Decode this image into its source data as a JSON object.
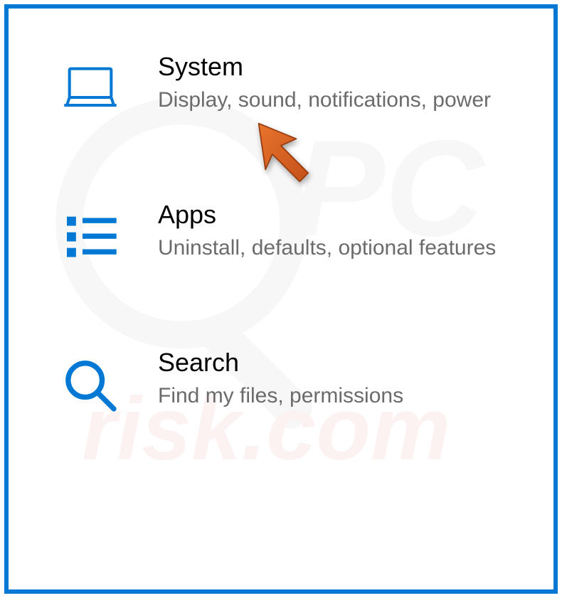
{
  "colors": {
    "border": "#0078d4",
    "icon": "#0078d4",
    "title": "#000000",
    "subtitle": "#6b6b6b",
    "cursor": "#d9641f"
  },
  "watermark": {
    "text_top": "PC",
    "text_bottom": "risk.com"
  },
  "settings": {
    "system": {
      "title": "System",
      "subtitle": "Display, sound, notifications, power"
    },
    "apps": {
      "title": "Apps",
      "subtitle": "Uninstall, defaults, optional features"
    },
    "search": {
      "title": "Search",
      "subtitle": "Find my files, permissions"
    }
  },
  "annotation": {
    "type": "cursor-arrow",
    "target": "system"
  }
}
